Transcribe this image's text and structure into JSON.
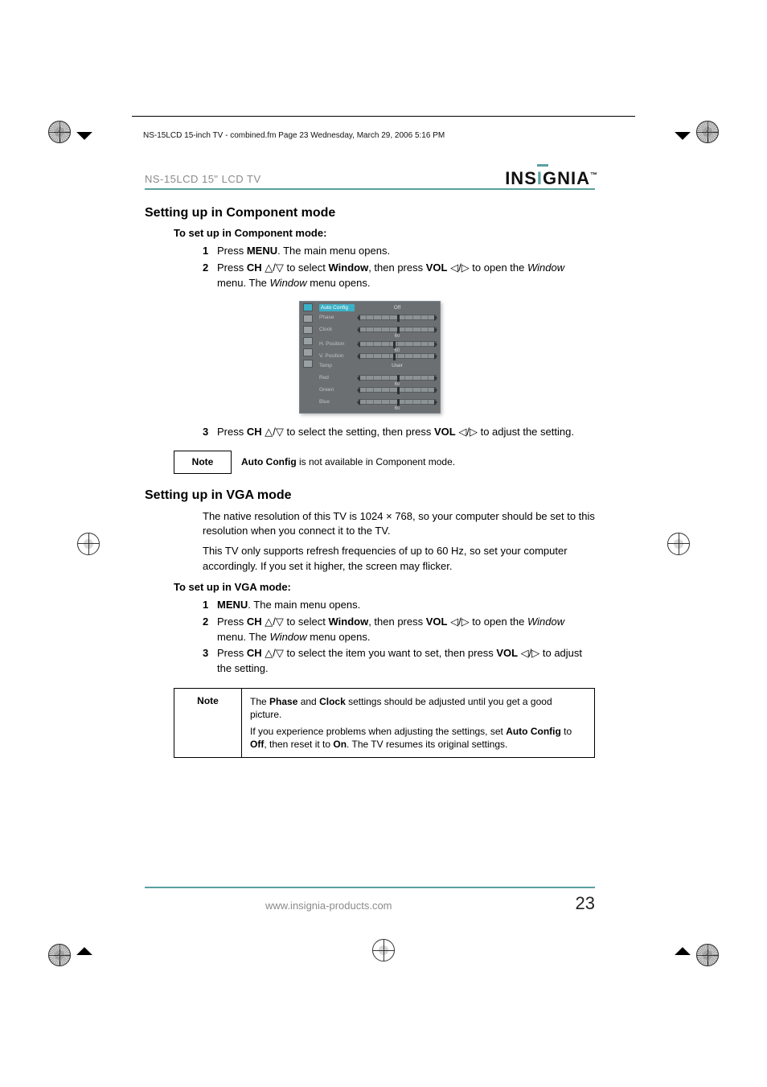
{
  "crop_header": "NS-15LCD 15-inch TV - combined.fm  Page 23  Wednesday, March 29, 2006  5:16 PM",
  "running_head": "NS-15LCD 15\" LCD TV",
  "brand_text_1": "INS",
  "brand_text_2": "I",
  "brand_text_3": "GNIA",
  "brand_tm": "™",
  "section1_title": "Setting up in Component mode",
  "section1_sub": "To set up in Component mode:",
  "s1_steps": [
    {
      "n": "1",
      "parts": [
        "Press ",
        "MENU",
        ". The main menu opens."
      ]
    },
    {
      "n": "2",
      "parts": [
        "Press ",
        "CH",
        " △/▽ to select ",
        "Window",
        ", then press ",
        "VOL",
        " ◁/▷ to open the ",
        "Window",
        " menu. The ",
        "Window",
        " menu opens."
      ]
    },
    {
      "n": "3",
      "parts": [
        "Press ",
        "CH",
        " △/▽ to select the setting, then press ",
        "VOL",
        " ◁/▷ to adjust the setting."
      ]
    }
  ],
  "osd": {
    "rows": [
      {
        "label": "Auto Config",
        "type": "value",
        "value": "Off",
        "selected": true
      },
      {
        "label": "Phase",
        "type": "slider",
        "value": "",
        "knob_pct": 50
      },
      {
        "label": "Clock",
        "type": "slider",
        "value": "60",
        "knob_pct": 50
      },
      {
        "label": "H. Position",
        "type": "slider",
        "value": "60",
        "knob_pct": 45
      },
      {
        "label": "V. Position",
        "type": "slider",
        "value": "",
        "knob_pct": 45
      },
      {
        "label": "Temp",
        "type": "value",
        "value": "User"
      },
      {
        "label": "Red",
        "type": "slider",
        "value": "60",
        "knob_pct": 50
      },
      {
        "label": "Green",
        "type": "slider",
        "value": "",
        "knob_pct": 50
      },
      {
        "label": "Blue",
        "type": "slider",
        "value": "60",
        "knob_pct": 50
      }
    ]
  },
  "note1_label": "Note",
  "note1_body_a": "Auto Config",
  "note1_body_b": " is not available in Component mode.",
  "section2_title": "Setting up in VGA mode",
  "vga_para1": "The native resolution of this TV is 1024 × 768, so your computer should be set to this resolution when you connect it to the TV.",
  "vga_para2": "This TV only supports refresh frequencies of up to 60 Hz, so set your computer accordingly. If you set it higher, the screen may flicker.",
  "section2_sub": "To set up in VGA mode:",
  "s2_steps": [
    {
      "n": "1",
      "parts": [
        "MENU",
        ". The main menu opens."
      ]
    },
    {
      "n": "2",
      "parts": [
        "Press ",
        "CH",
        " △/▽ to select ",
        "Window",
        ", then press ",
        "VOL",
        " ◁/▷ to open the ",
        "Window",
        " menu. The ",
        "Window",
        " menu opens."
      ]
    },
    {
      "n": "3",
      "parts": [
        "Press ",
        "CH",
        " △/▽ to select the item you want to set, then press ",
        "VOL",
        " ◁/▷ to adjust the setting."
      ]
    }
  ],
  "note2_label": "Note",
  "note2_p1_a": "The ",
  "note2_p1_b": "Phase",
  "note2_p1_c": " and ",
  "note2_p1_d": "Clock",
  "note2_p1_e": " settings should be adjusted until you get a good picture.",
  "note2_p2_a": "If you experience problems when adjusting the settings, set ",
  "note2_p2_b": "Auto Config",
  "note2_p2_c": " to ",
  "note2_p2_d": "Off",
  "note2_p2_e": ", then reset it to ",
  "note2_p2_f": "On",
  "note2_p2_g": ". The TV resumes its original settings.",
  "footer_url": "www.insignia-products.com",
  "page_number": "23"
}
